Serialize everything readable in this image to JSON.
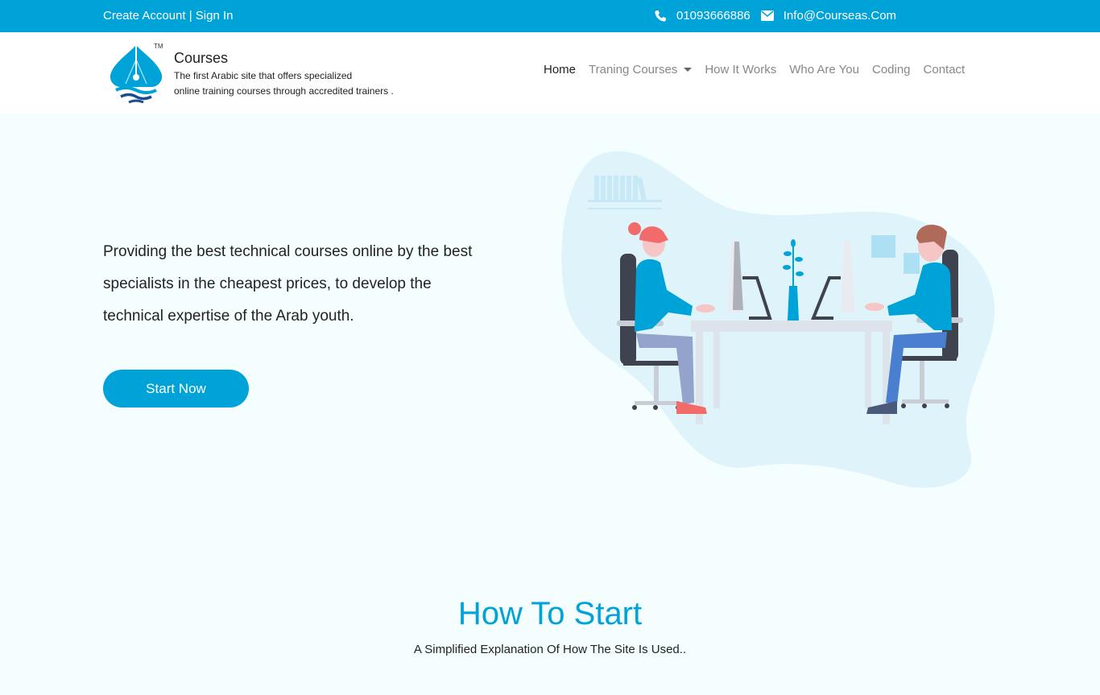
{
  "topbar": {
    "create_account": "Create Account",
    "separator": " | ",
    "sign_in": "Sign In",
    "phone": "01093666886",
    "email": "Info@Courseas.Com",
    "icons": [
      "phone-icon",
      "envelope-icon"
    ]
  },
  "brand": {
    "name": "Courses",
    "desc_line1": "The first Arabic site that offers specialized",
    "desc_line2": "online training courses through accredited trainers .",
    "trademark": "TM"
  },
  "nav": {
    "home": "Home",
    "training": "Traning Courses",
    "how": "How It Works",
    "who": "Who Are You",
    "coding": "Coding",
    "contact": "Contact"
  },
  "hero": {
    "line1": "Providing the best technical courses online by the best",
    "line2": "specialists in the cheapest prices, to develop the",
    "line3": "technical expertise of the Arab youth.",
    "cta": "Start Now"
  },
  "section": {
    "title": "How To Start",
    "subtitle": "A Simplified Explanation Of How The Site Is Used.."
  },
  "colors": {
    "primary": "#00a3d8",
    "background": "#f5fefe",
    "blob": "#dff3fb"
  }
}
